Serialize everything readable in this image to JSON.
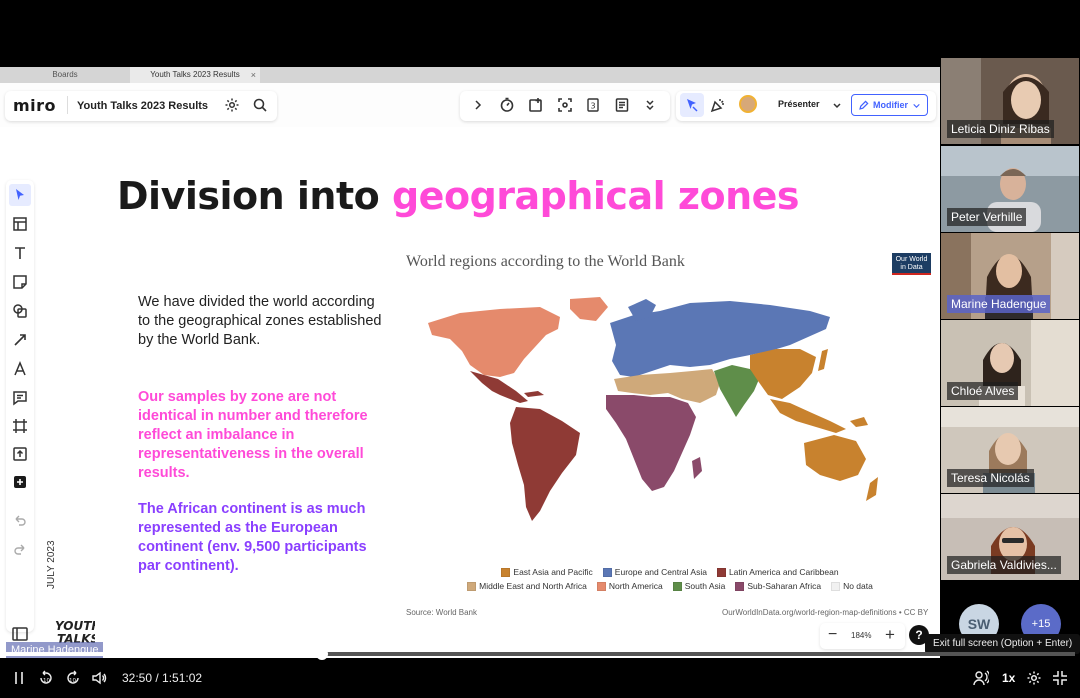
{
  "browser_tabs": [
    {
      "label": "Boards",
      "active": false
    },
    {
      "label": "Youth Talks 2023 Results",
      "active": true,
      "close": "×"
    }
  ],
  "miro": {
    "logo": "miro",
    "board_title": "Youth Talks 2023 Results",
    "presenter_label": "Présenter",
    "modify_label": "Modifier",
    "zoom": {
      "level": "184%",
      "minus": "−",
      "plus": "+"
    },
    "help": "?",
    "active_tool": "select"
  },
  "slide": {
    "title_plain": "Division into ",
    "title_highlight": "geographical zones",
    "paragraph1": "We have divided the world according to the geographical zones established by the World Bank.",
    "paragraph2": "Our samples by zone are not identical in number and therefore reflect an imbalance in representativeness in the overall results.",
    "paragraph3": "The African continent is as much represented as the European continent (env. 9,500 participants par continent).",
    "date_vertical": "JULY 2023",
    "logo_text": "YOUTH TALKS"
  },
  "map": {
    "title": "World regions according to the World Bank",
    "badge": "Our World in Data",
    "source": "Source: World Bank",
    "link": "OurWorldInData.org/world-region-map-definitions • CC BY",
    "legend_row1": [
      {
        "label": "East Asia and Pacific",
        "color": "#c8822e"
      },
      {
        "label": "Europe and Central Asia",
        "color": "#5b77b5"
      },
      {
        "label": "Latin America and Caribbean",
        "color": "#8f3a35"
      }
    ],
    "legend_row2": [
      {
        "label": "Middle East and North Africa",
        "color": "#cfa97a"
      },
      {
        "label": "North America",
        "color": "#e58a6c"
      },
      {
        "label": "South Asia",
        "color": "#5f8e4a"
      },
      {
        "label": "Sub-Saharan Africa",
        "color": "#8a4a6a"
      },
      {
        "label": "No data",
        "color": "#f1f1f1"
      }
    ]
  },
  "speaker_label": "Marine Hadengue",
  "participants": [
    {
      "name": "Leticia Diniz Ribas",
      "bg": "#6a5a4e"
    },
    {
      "name": "Peter Verhille",
      "bg": "#8d9aa2"
    },
    {
      "name": "Marine Hadengue",
      "bg": "#b6a08a",
      "speaking": true
    },
    {
      "name": "Chloé Alves",
      "bg": "#c9c1b4"
    },
    {
      "name": "Teresa Nicolás",
      "bg": "#cfc7bc"
    },
    {
      "name": "Gabriela Valdivies...",
      "bg": "#c7beb6"
    }
  ],
  "overflow": {
    "initials": "SW",
    "more": "+15"
  },
  "tooltip": "Exit full screen (Option + Enter)",
  "player": {
    "current": "32:50",
    "total": "1:51:02",
    "time_readout": "32:50 / 1:51:02",
    "progress": 0.296,
    "speed": "1x"
  }
}
